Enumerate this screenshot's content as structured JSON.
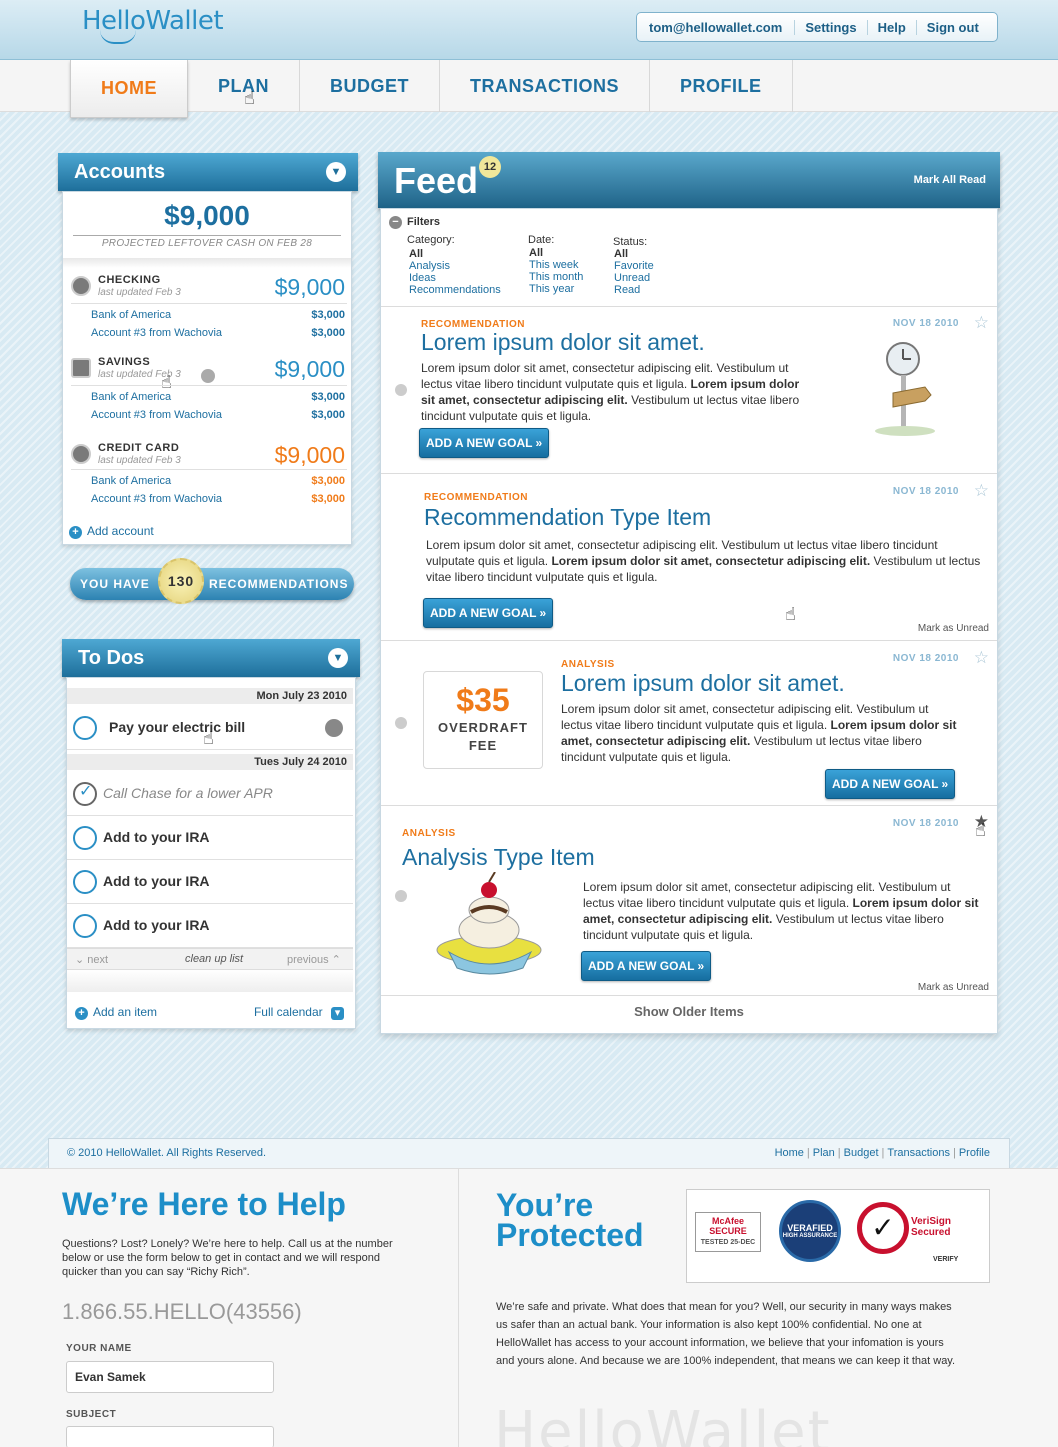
{
  "header": {
    "logo": "HelloWallet",
    "user_email": "tom@hellowallet.com",
    "settings": "Settings",
    "help": "Help",
    "sign_out": "Sign out"
  },
  "nav": [
    "HOME",
    "PLAN",
    "BUDGET",
    "TRANSACTIONS",
    "PROFILE"
  ],
  "accounts": {
    "title": "Accounts",
    "total": "$9,000",
    "projected": "PROJECTED LEFTOVER CASH ON FEB 28",
    "groups": [
      {
        "name": "CHECKING",
        "updated": "last updated Feb 3",
        "amount": "$9,000",
        "color": "#2a8fc5",
        "items": [
          {
            "name": "Bank of America",
            "value": "$3,000"
          },
          {
            "name": "Account #3 from Wachovia",
            "value": "$3,000"
          }
        ]
      },
      {
        "name": "SAVINGS",
        "updated": "last updated Feb 3",
        "amount": "$9,000",
        "color": "#2a8fc5",
        "items": [
          {
            "name": "Bank of America",
            "value": "$3,000"
          },
          {
            "name": "Account #3 from Wachovia",
            "value": "$3,000"
          }
        ]
      },
      {
        "name": "CREDIT CARD",
        "updated": "last updated Feb 3",
        "amount": "$9,000",
        "color": "#f07b19",
        "items": [
          {
            "name": "Bank of America",
            "value": "$3,000"
          },
          {
            "name": "Account #3 from Wachovia",
            "value": "$3,000"
          }
        ]
      }
    ],
    "add_account": "Add account"
  },
  "recommendations": {
    "prefix": "YOU HAVE",
    "count": "130",
    "suffix": "RECOMMENDATIONS"
  },
  "todos": {
    "title": "To Dos",
    "date1": "Mon July 23 2010",
    "date2": "Tues July 24 2010",
    "items": [
      "Pay your electric bill",
      "Call Chase for a lower APR",
      "Add to your IRA",
      "Add to your IRA",
      "Add to your IRA"
    ],
    "pager": {
      "next": "next",
      "clean": "clean up list",
      "previous": "previous"
    },
    "add_item": "Add an item",
    "calendar": "Full calendar"
  },
  "feed": {
    "title": "Feed",
    "count": "12",
    "mark_all_read": "Mark All Read",
    "filters": {
      "title": "Filters",
      "category_label": "Category:",
      "category": [
        "All",
        "Analysis",
        "Ideas",
        "Recommendations"
      ],
      "date_label": "Date:",
      "date": [
        "All",
        "This week",
        "This month",
        "This year"
      ],
      "status_label": "Status:",
      "status": [
        "All",
        "Favorite",
        "Unread",
        "Read"
      ]
    },
    "items": [
      {
        "type": "RECOMMENDATION",
        "title": "Lorem ipsum dolor sit amet.",
        "date": "NOV 18 2010",
        "text1": "Lorem ipsum dolor sit amet, consectetur adipiscing elit. Vestibulum ut lectus vitae libero tincidunt vulputate quis et ligula.",
        "bold": "Lorem ipsum dolor sit amet, consectetur adipiscing elit.",
        "text2": "Vestibulum ut lectus vitae libero tincidunt vulputate quis et ligula.",
        "button": "ADD A NEW GOAL »"
      },
      {
        "type": "RECOMMENDATION",
        "title": "Recommendation Type Item",
        "date": "NOV 18 2010",
        "text1": "Lorem ipsum dolor sit amet, consectetur adipiscing elit. Vestibulum ut lectus vitae libero tincidunt vulputate quis et ligula.",
        "bold": "Lorem ipsum dolor sit amet, consectetur adipiscing elit.",
        "text2": "Vestibulum ut lectus vitae libero tincidunt vulputate quis et ligula.",
        "button": "ADD A NEW GOAL »",
        "mark": "Mark as Unread"
      },
      {
        "type": "ANALYSIS",
        "title": "Lorem ipsum dolor sit amet.",
        "date": "NOV 18 2010",
        "fee_amount": "$35",
        "fee_line1": "OVERDRAFT",
        "fee_line2": "FEE",
        "text1": "Lorem ipsum dolor sit amet, consectetur adipiscing elit. Vestibulum ut lectus vitae libero tincidunt vulputate quis et ligula.",
        "bold": "Lorem ipsum dolor sit amet, consectetur adipiscing elit.",
        "text2": "Vestibulum ut lectus vitae libero tincidunt vulputate quis et ligula.",
        "button": "ADD A NEW GOAL »"
      },
      {
        "type": "ANALYSIS",
        "title": "Analysis Type Item",
        "date": "NOV 18 2010",
        "text1": "Lorem ipsum dolor sit amet, consectetur adipiscing elit. Vestibulum ut lectus vitae libero tincidunt vulputate quis et ligula.",
        "bold": "Lorem ipsum dolor sit amet, consectetur adipiscing elit.",
        "text2": "Vestibulum ut lectus vitae libero tincidunt vulputate quis et ligula.",
        "button": "ADD A NEW GOAL »",
        "mark": "Mark as Unread"
      }
    ],
    "show_older": "Show Older Items"
  },
  "footer": {
    "copyright": "© 2010 HelloWallet. All Rights Reserved.",
    "links": [
      "Home",
      "Plan",
      "Budget",
      "Transactions",
      "Profile"
    ],
    "help_title": "We’re Here to Help",
    "help_text": "Questions? Lost? Lonely? We’re here to help.  Call us at the number below or use the form below to get in contact and we will respond quicker than you can say “Richy Rich”.",
    "phone": "1.866.55.HELLO(43556)",
    "name_label": "YOUR NAME",
    "name_value": "Evan Samek",
    "subject_label": "SUBJECT",
    "protected_title": "You’re Protected",
    "badge_mcafee": "McAfee SECURE",
    "badge_mcafee_sub": "TESTED 25-DEC",
    "badge_verafied": "VERAFIED",
    "badge_verafied_sub": "HIGH ASSURANCE",
    "badge_verisign": "VeriSign Secured",
    "badge_verisign_sub": "VERIFY",
    "protected_text": "We’re safe and private.  What does that mean for you? Well, our security in many ways makes us safer than an actual bank.  Your information is also kept 100% confidential.  No one at HelloWallet has access to your account information, we believe that your infomation is yours and yours alone.  And because we are 100% independent, that means we can keep it that way.",
    "watermark": "HelloWallet"
  },
  "colors": {
    "accent": "#2a8fc5",
    "orange": "#f07b19",
    "header_dark": "#1e6f9b"
  }
}
